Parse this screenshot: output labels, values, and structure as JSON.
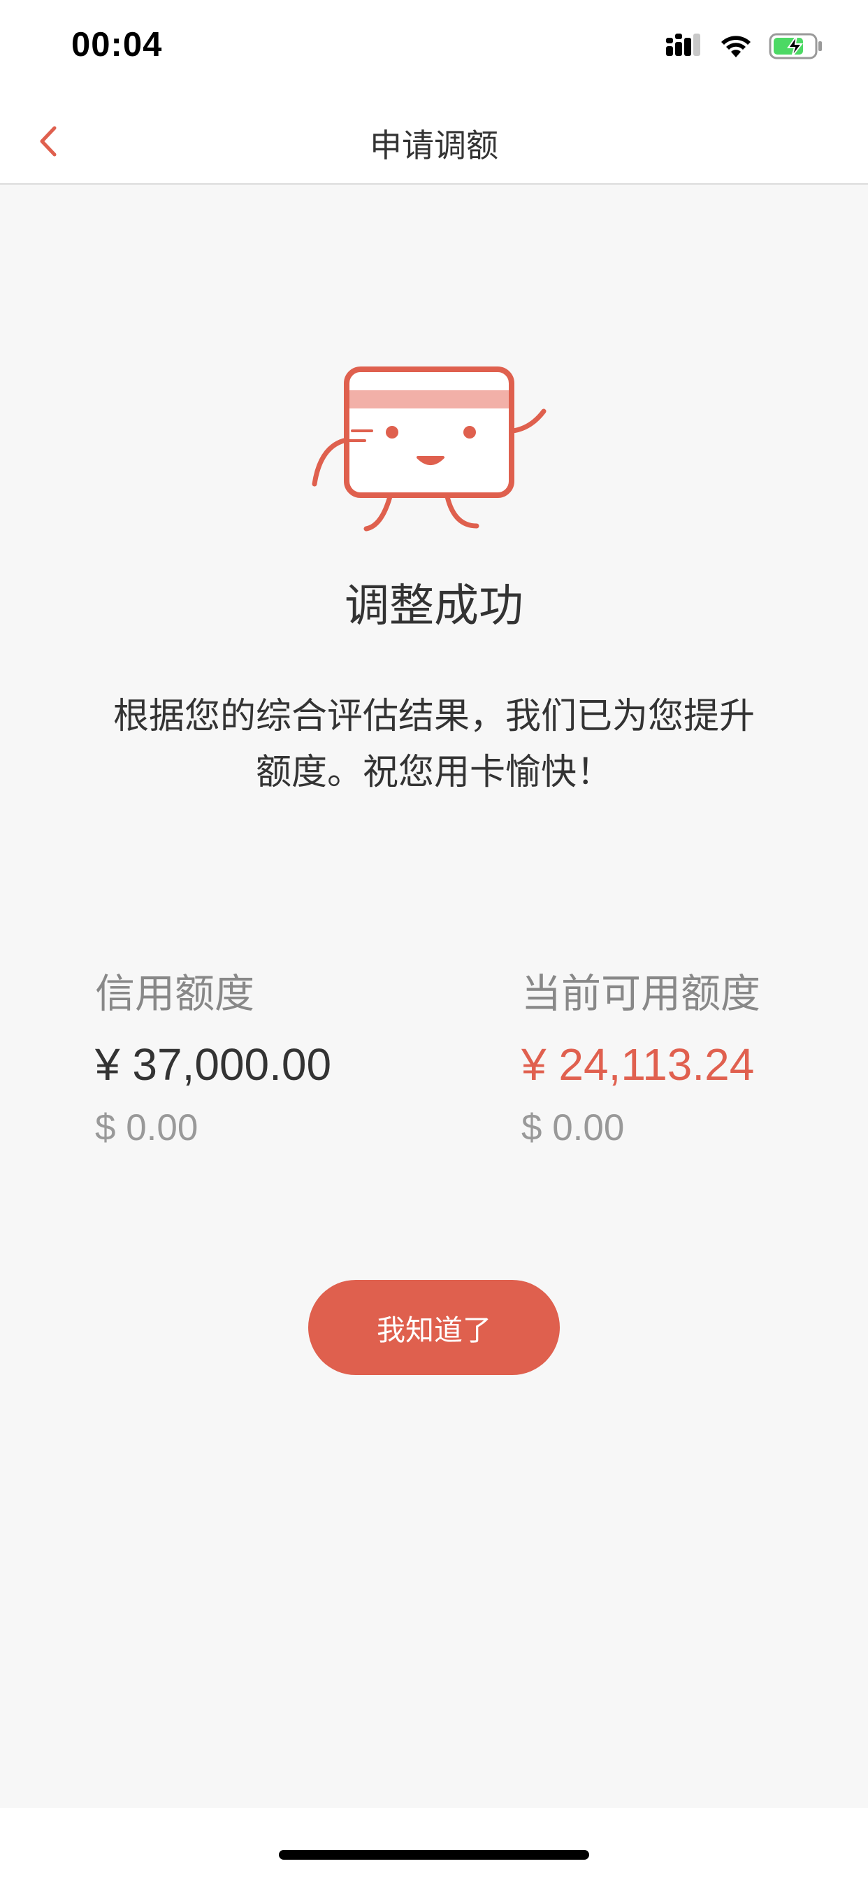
{
  "status_bar": {
    "time": "00:04",
    "icons": [
      "signal-icon",
      "wifi-icon",
      "battery-charging-icon"
    ]
  },
  "nav": {
    "back_icon": "chevron-left-icon",
    "title": "申请调额"
  },
  "result": {
    "illustration": "card-mascot-icon",
    "title": "调整成功",
    "message": "根据您的综合评估结果，我们已为您提升额度。祝您用卡愉快！"
  },
  "credit_limit": {
    "label": "信用额度",
    "rmb": "¥ 37,000.00",
    "usd": "$ 0.00"
  },
  "available_limit": {
    "label": "当前可用额度",
    "rmb": "¥ 24,113.24",
    "usd": "$ 0.00"
  },
  "confirm_button": {
    "label": "我知道了"
  },
  "colors": {
    "accent": "#df604e",
    "background": "#f7f7f7",
    "text_primary": "#333333",
    "text_secondary": "#888888"
  }
}
